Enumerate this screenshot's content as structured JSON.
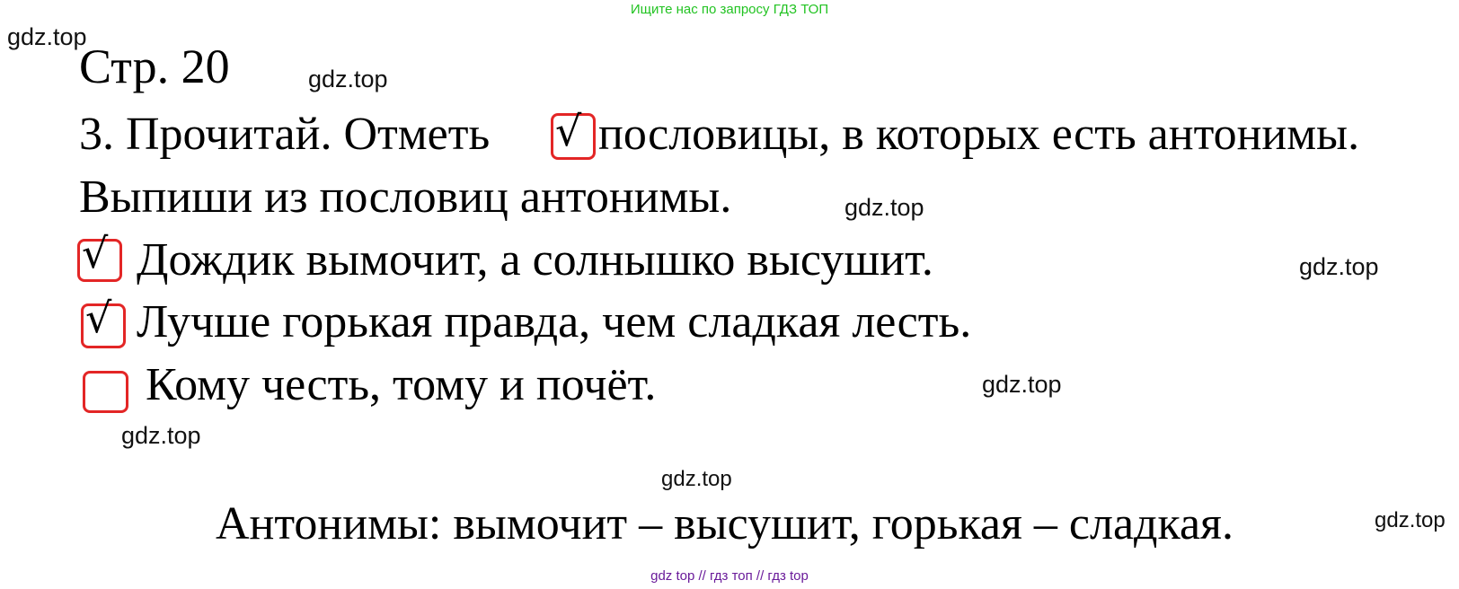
{
  "banner": "Ищите нас по запросу ГДЗ ТОП",
  "watermark": "gdz.top",
  "page_ref": "Стр. 20",
  "task": {
    "line1_before": "3. Прочитай. Отметь",
    "check_mark": "√",
    "line1_after": "пословицы, в которых есть антонимы.",
    "line2": "Выпиши из пословиц антонимы."
  },
  "proverbs": [
    {
      "text": "Дождик вымочит, а солнышко высушит.",
      "checked": true
    },
    {
      "text": "Лучше горькая правда, чем сладкая лесть.",
      "checked": true
    },
    {
      "text": "Кому честь, тому и почёт.",
      "checked": false
    }
  ],
  "answer": "Антонимы: вымочит – высушит, горькая – сладкая.",
  "footer": "gdz top  //  гдз топ  //  гдз top",
  "colors": {
    "banner": "#22c322",
    "checkbox_border": "#e32626",
    "footer": "#6a1b9a"
  }
}
